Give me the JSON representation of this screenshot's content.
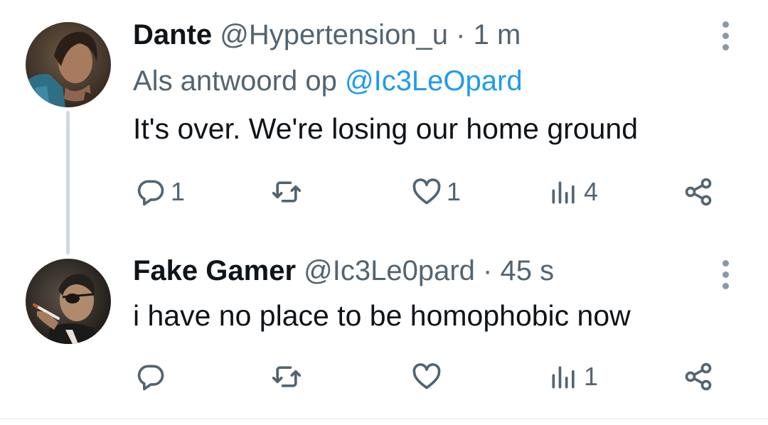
{
  "tweets": [
    {
      "name": "Dante",
      "handle": "@Hypertension_u",
      "separator": "·",
      "time": "1 m",
      "reply_prefix": "Als antwoord op",
      "reply_mention": "@Ic3LeOpard",
      "text": "It's over. We're losing our home ground",
      "actions": {
        "replies": "1",
        "retweets": "",
        "likes": "1",
        "views": "4"
      },
      "icons": {
        "avatar": "avatar-image",
        "reply": "reply-icon",
        "retweet": "retweet-icon",
        "like": "heart-icon",
        "views": "analytics-icon",
        "share": "share-icon",
        "more": "more-icon"
      }
    },
    {
      "name": "Fake Gamer",
      "handle": "@Ic3Le0pard",
      "separator": "·",
      "time": "45 s",
      "text": "i have no place to be homophobic now",
      "actions": {
        "replies": "",
        "retweets": "",
        "likes": "",
        "views": "1"
      },
      "icons": {
        "avatar": "avatar-image",
        "reply": "reply-icon",
        "retweet": "retweet-icon",
        "like": "heart-icon",
        "views": "analytics-icon",
        "share": "share-icon",
        "more": "more-icon"
      }
    }
  ],
  "colors": {
    "text": "#0f1419",
    "secondary": "#536471",
    "link": "#1d9bf0",
    "thread_line": "#cfd9de"
  }
}
